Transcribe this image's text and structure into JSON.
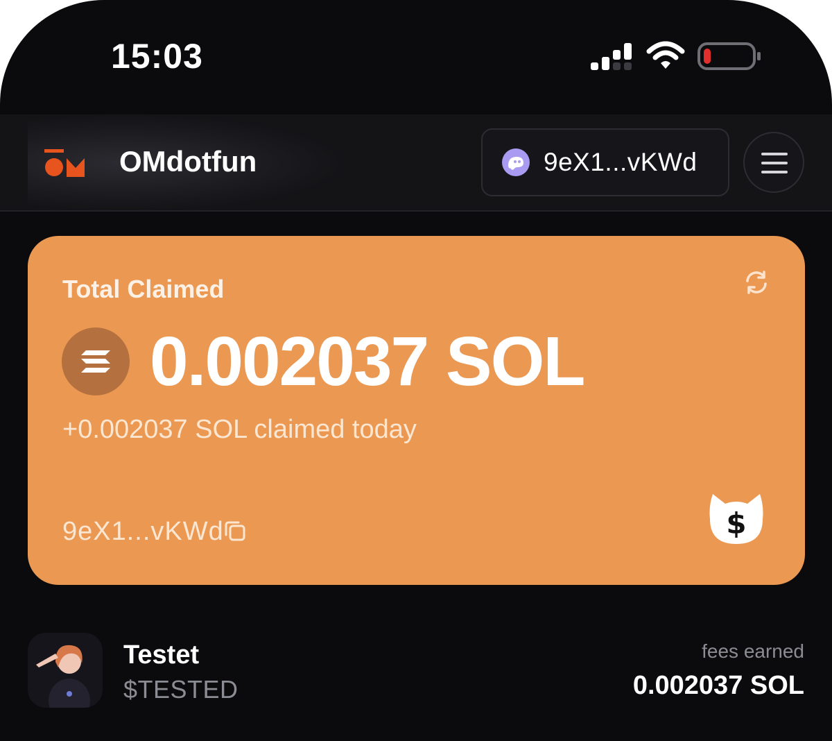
{
  "status_bar": {
    "time": "15:03",
    "icons": [
      "signal-icon",
      "wifi-icon",
      "battery-low-icon"
    ],
    "battery_color": "#e0302e"
  },
  "header": {
    "brand_name": "OMdotfun",
    "brand_color": "#e8541e",
    "wallet_address": "9eX1...vKWd",
    "icons": [
      "phantom-wallet-icon",
      "hamburger-menu-icon"
    ]
  },
  "claim_card": {
    "title": "Total Claimed",
    "amount": "0.002037 SOL",
    "today": "+0.002037 SOL claimed today",
    "address": "9eX1...vKWd",
    "accent_color": "#eb9852",
    "icons": [
      "refresh-icon",
      "solana-icon",
      "copy-icon",
      "cat-dollar-icon"
    ]
  },
  "tokens": [
    {
      "name": "Testet",
      "ticker": "$TESTED",
      "fees_label": "fees earned",
      "fees_value": "0.002037 SOL"
    }
  ]
}
